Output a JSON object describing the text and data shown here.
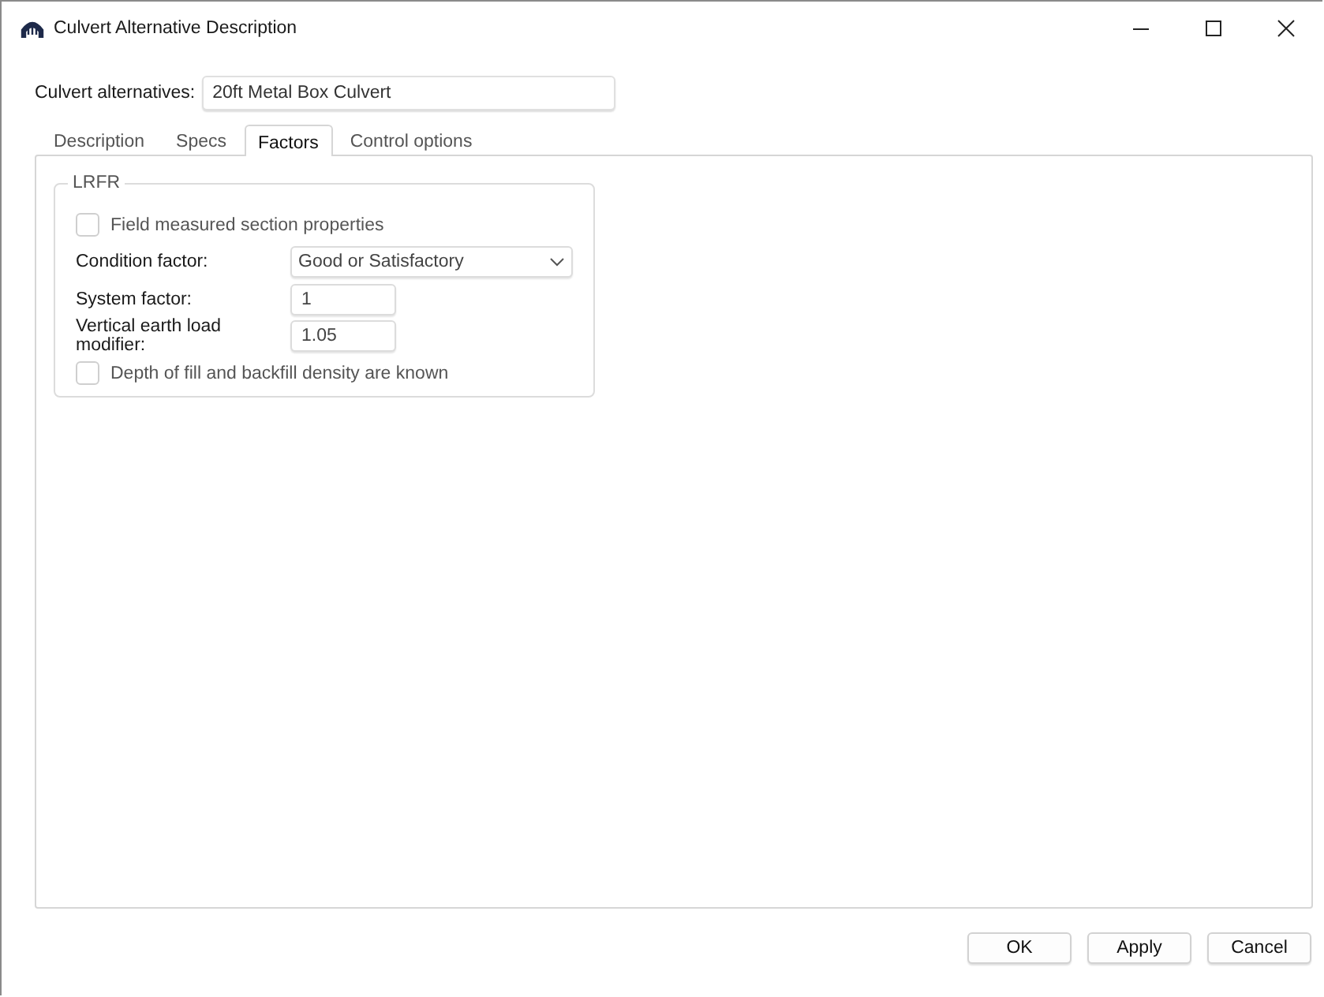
{
  "window": {
    "title": "Culvert Alternative Description"
  },
  "alternative": {
    "label": "Culvert alternatives:",
    "value": "20ft Metal Box Culvert"
  },
  "tabs": [
    {
      "label": "Description",
      "selected": false
    },
    {
      "label": "Specs",
      "selected": false
    },
    {
      "label": "Factors",
      "selected": true
    },
    {
      "label": "Control options",
      "selected": false
    }
  ],
  "group": {
    "title": "LRFR",
    "rows": [
      {
        "kind": "checkbox",
        "label": "Field measured section properties",
        "checked": false
      },
      {
        "kind": "dropdown",
        "label": "Condition factor:",
        "value": "Good or Satisfactory"
      },
      {
        "kind": "text",
        "label": "System factor:",
        "value": "1"
      },
      {
        "kind": "text",
        "label": "Vertical earth load modifier:",
        "value": "1.05"
      },
      {
        "kind": "checkbox",
        "label": "Depth of fill and backfill density are known",
        "checked": false
      }
    ]
  },
  "buttons": [
    "OK",
    "Apply",
    "Cancel"
  ]
}
